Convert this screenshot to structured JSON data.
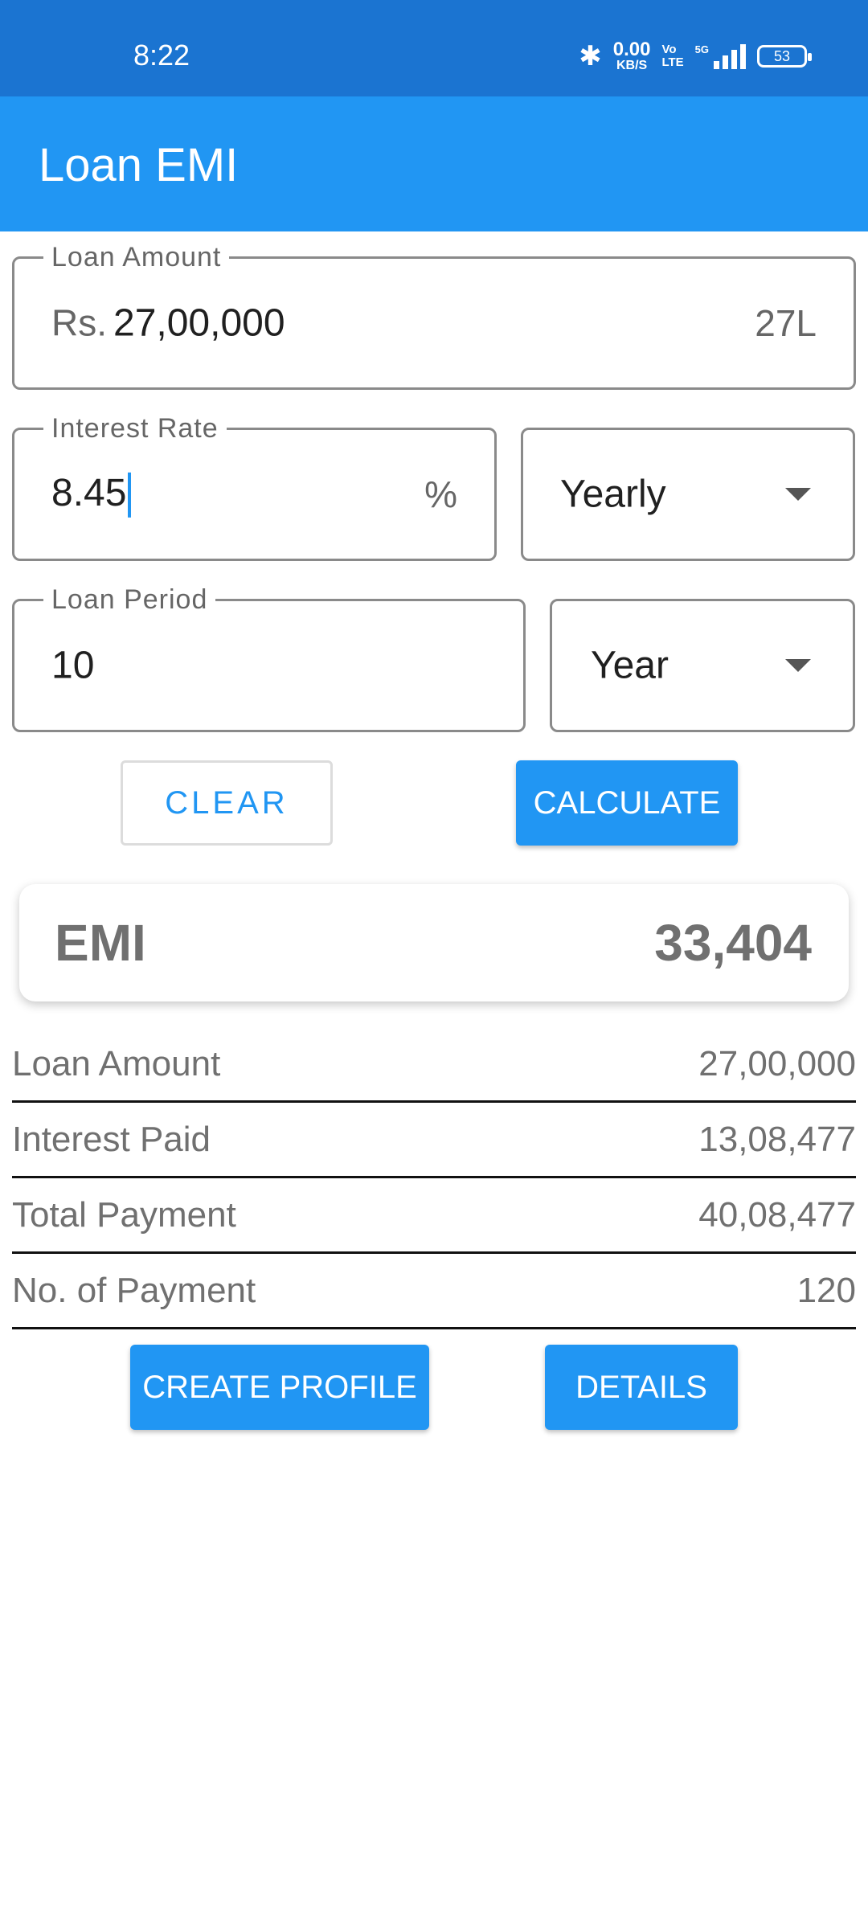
{
  "status_bar": {
    "time": "8:22",
    "net_speed_value": "0.00",
    "net_speed_unit": "KB/S",
    "volte_top": "Vo",
    "volte_bottom": "LTE",
    "network": "5G",
    "battery": "53"
  },
  "app_bar": {
    "title": "Loan EMI"
  },
  "form": {
    "loan_amount": {
      "label": "Loan Amount",
      "prefix": "Rs.",
      "value": "27,00,000",
      "suffix": "27L"
    },
    "interest_rate": {
      "label": "Interest Rate",
      "value": "8.45",
      "suffix": "%"
    },
    "interest_period": {
      "selected": "Yearly"
    },
    "loan_period": {
      "label": "Loan Period",
      "value": "10"
    },
    "loan_period_unit": {
      "selected": "Year"
    }
  },
  "buttons": {
    "clear": "CLEAR",
    "calculate": "CALCULATE",
    "create_profile": "CREATE PROFILE",
    "details": "DETAILS"
  },
  "emi": {
    "label": "EMI",
    "value": "33,404"
  },
  "summary": [
    {
      "label": "Loan Amount",
      "value": "27,00,000"
    },
    {
      "label": "Interest Paid",
      "value": "13,08,477"
    },
    {
      "label": "Total Payment",
      "value": "40,08,477"
    },
    {
      "label": "No. of Payment",
      "value": "120"
    }
  ],
  "colors": {
    "status_bar": "#1b74d1",
    "app_bar": "#2196f3",
    "accent": "#2196f3"
  }
}
